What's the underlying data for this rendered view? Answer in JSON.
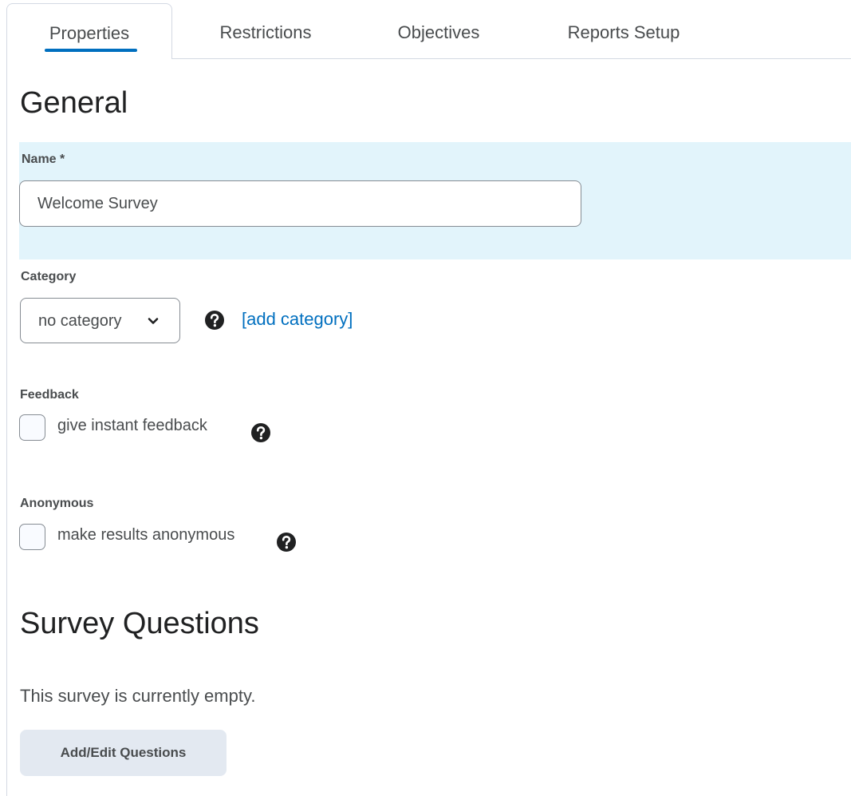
{
  "tabs": [
    {
      "label": "Properties",
      "active": true
    },
    {
      "label": "Restrictions",
      "active": false
    },
    {
      "label": "Objectives",
      "active": false
    },
    {
      "label": "Reports Setup",
      "active": false
    }
  ],
  "general": {
    "title": "General",
    "name": {
      "label": "Name",
      "required_marker": "*",
      "value": "Welcome Survey"
    },
    "category": {
      "label": "Category",
      "selected": "no category",
      "help_icon": "question-circle-icon",
      "add_link": "[add category]"
    },
    "feedback": {
      "label": "Feedback",
      "checkbox_label": "give instant feedback",
      "checked": false,
      "help_icon": "question-circle-icon"
    },
    "anonymous": {
      "label": "Anonymous",
      "checkbox_label": "make results anonymous",
      "checked": false,
      "help_icon": "question-circle-icon"
    }
  },
  "survey_questions": {
    "title": "Survey Questions",
    "empty_message": "This survey is currently empty.",
    "add_edit_button": "Add/Edit Questions"
  },
  "colors": {
    "accent": "#006fbf",
    "name_panel_bg": "#e2f4fb",
    "button_bg": "#e3e9f1",
    "text": "#494c4e"
  }
}
